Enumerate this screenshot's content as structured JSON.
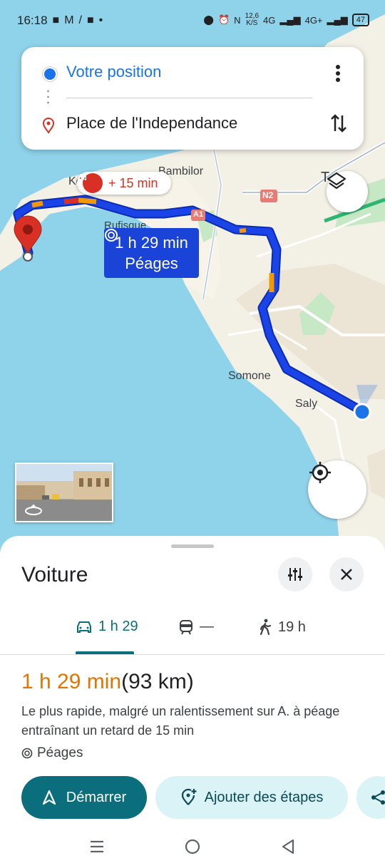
{
  "status_bar": {
    "time": "16:18",
    "speed": "12,6",
    "speed_unit": "K/S",
    "net1": "4G",
    "net2": "4G+",
    "battery": "47"
  },
  "directions": {
    "origin": "Votre position",
    "destination": "Place de l'Independance"
  },
  "map": {
    "traffic_badge": "+ 15 min",
    "route_label_time": "1 h 29 min",
    "route_label_tolls": "Péages",
    "labels": {
      "bambilor": "Bambilor",
      "ke": "Ke",
      "rufisque": "Rufisque",
      "somone": "Somone",
      "saly": "Saly",
      "t": "T",
      "n2": "N2",
      "a1": "A1"
    }
  },
  "sheet": {
    "title": "Voiture",
    "tabs": [
      {
        "icon": "car-icon",
        "label": "1 h 29"
      },
      {
        "icon": "train-icon",
        "label": "—"
      },
      {
        "icon": "walk-icon",
        "label": "19 h"
      }
    ],
    "route_time": "1 h 29 min",
    "route_distance": "(93 km)",
    "description": "Le plus rapide, malgré un ralentissement sur A. à péage entraînant un retard de 15 min",
    "tolls": "Péages",
    "start_button": "Démarrer",
    "add_stops_button": "Ajouter des étapes"
  },
  "colors": {
    "route": "#1a43d8",
    "accent": "#0b6e7c",
    "delay": "#e37400",
    "traffic": "#d93025"
  }
}
